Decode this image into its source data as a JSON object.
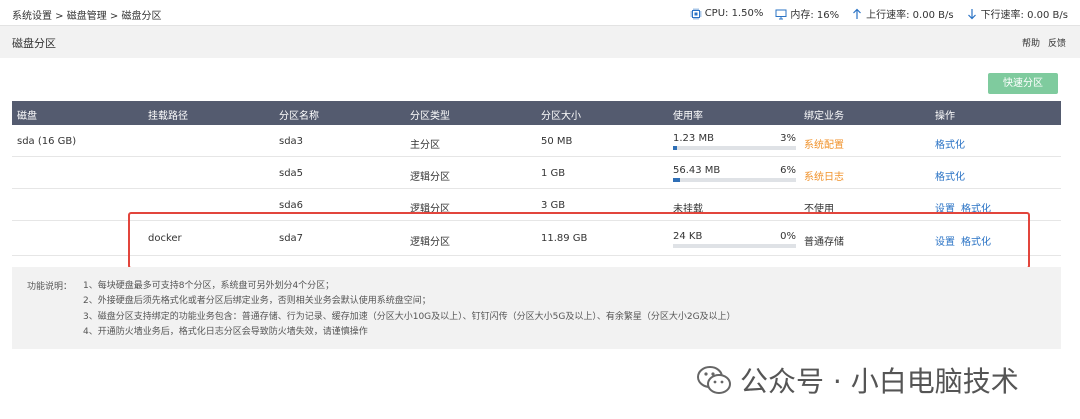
{
  "breadcrumb": "系统设置 > 磁盘管理 > 磁盘分区",
  "stats": {
    "cpu": "CPU: 1.50%",
    "mem": "内存: 16%",
    "up": "上行速率: 0.00 B/s",
    "down": "下行速率: 0.00 B/s"
  },
  "title": "磁盘分区",
  "help": "帮助",
  "feedback": "反馈",
  "quick_partition": "快速分区",
  "headers": [
    "磁盘",
    "挂载路径",
    "分区名称",
    "分区类型",
    "分区大小",
    "使用率",
    "绑定业务",
    "操作"
  ],
  "rows": [
    {
      "disk": "sda (16 GB)",
      "mount": "",
      "name": "sda3",
      "type": "主分区",
      "size": "50 MB",
      "usage_text": "1.23 MB",
      "usage_pct": "3%",
      "usage_fraction": 0.03,
      "binding": "系统配置",
      "binding_color": "#f0922b",
      "op1": "",
      "op2": "格式化"
    },
    {
      "disk": "",
      "mount": "",
      "name": "sda5",
      "type": "逻辑分区",
      "size": "1 GB",
      "usage_text": "56.43 MB",
      "usage_pct": "6%",
      "usage_fraction": 0.06,
      "binding": "系统日志",
      "binding_color": "#f0922b",
      "op1": "",
      "op2": "格式化"
    },
    {
      "disk": "",
      "mount": "",
      "name": "sda6",
      "type": "逻辑分区",
      "size": "3 GB",
      "usage_text": "未挂载",
      "binding": "不使用",
      "op1": "设置",
      "op2": "格式化"
    },
    {
      "disk": "",
      "mount": "docker",
      "name": "sda7",
      "type": "逻辑分区",
      "size": "11.89 GB",
      "usage_text": "24 KB",
      "usage_pct": "0%",
      "usage_fraction": 0.0,
      "binding": "普通存储",
      "op1": "设置",
      "op2": "格式化"
    }
  ],
  "desc": {
    "label": "功能说明：",
    "lines": [
      "1、每块硬盘最多可支持8个分区，系统盘可另外划分4个分区；",
      "2、外接硬盘后须先格式化或者分区后绑定业务，否则相关业务会默认使用系统盘空间；",
      "3、磁盘分区支持绑定的功能业务包含：普通存储、行为记录、缓存加速（分区大小10G及以上）、钉钉闪传（分区大小5G及以上）、有余繁星（分区大小2G及以上）",
      "4、开通防火墙业务后，格式化日志分区会导致防火墙失效，请谨慎操作"
    ]
  },
  "watermark": "公众号 · 小白电脑技术",
  "colors": {
    "header_bg": "#545b6f",
    "accent_green": "#7fcb9e",
    "link": "#2a73c5",
    "warning": "#f0922b",
    "highlight": "#e2453c"
  }
}
